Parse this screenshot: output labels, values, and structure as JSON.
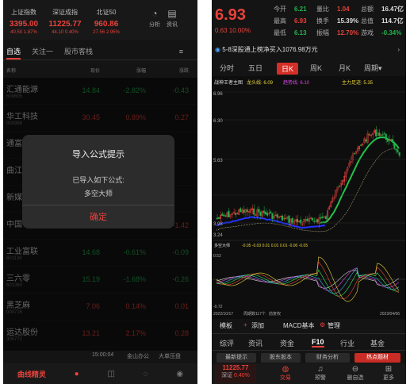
{
  "left": {
    "indices": [
      {
        "name": "上证指数",
        "value": "3395.00",
        "change": "40.50 1.87%",
        "color": "#e8413a"
      },
      {
        "name": "深证成指",
        "value": "11225.77",
        "change": "44.10 0.40%",
        "color": "#e8413a"
      },
      {
        "name": "北证50",
        "value": "960.86",
        "change": "27.56 2.95%",
        "color": "#e8413a"
      }
    ],
    "icons": [
      {
        "label": "分析",
        "icon": "chart-icon"
      },
      {
        "label": "资讯",
        "icon": "news-icon"
      }
    ],
    "tabs": {
      "selfselect": "自选",
      "follow": "关注一",
      "holding": "股市客栈"
    },
    "header": {
      "name": "名称",
      "price": "现价",
      "pct": "涨幅",
      "chg": "涨跌"
    },
    "stocks": [
      {
        "name": "汇通能源",
        "code": "600605",
        "price": "14.84",
        "pct": "-2.82%",
        "chg": "-0.43",
        "color": "#22b24c"
      },
      {
        "name": "华工科技",
        "code": "000988",
        "price": "30.45",
        "pct": "0.89%",
        "chg": "0.27",
        "color": "#e8413a"
      },
      {
        "name": "通富",
        "code": "",
        "price": "",
        "pct": "",
        "chg": "",
        "color": "#e8413a"
      },
      {
        "name": "曲江",
        "code": "",
        "price": "",
        "pct": "",
        "chg": "",
        "color": "#e8413a"
      },
      {
        "name": "新媒",
        "code": "",
        "price": "",
        "pct": "",
        "chg": "",
        "color": "#e8413a"
      },
      {
        "name": "中国",
        "code": "",
        "price": "",
        "pct": "",
        "chg": "-1.42",
        "color": "#e8413a"
      },
      {
        "name": "工业富联",
        "code": "601138",
        "price": "14.68",
        "pct": "-0.61%",
        "chg": "-0.09",
        "color": "#22b24c"
      },
      {
        "name": "三六零",
        "code": "601360",
        "price": "15.19",
        "pct": "-1.68%",
        "chg": "-0.26",
        "color": "#22b24c"
      },
      {
        "name": "黑芝麻",
        "code": "000716",
        "price": "7.06",
        "pct": "0.14%",
        "chg": "0.01",
        "color": "#e8413a"
      },
      {
        "name": "运达股份",
        "code": "300772",
        "price": "13.21",
        "pct": "2.17%",
        "chg": "0.28",
        "color": "#e8413a"
      }
    ],
    "dialog": {
      "title": "导入公式提示",
      "line1": "已导入如下公式:",
      "line2": "多空大师",
      "ok": "确定"
    },
    "footer": {
      "time": "15:00:04",
      "ad1": "金山办公",
      "ad2": "大单压盘"
    },
    "nav": {
      "brand": "曲线精灵"
    }
  },
  "right": {
    "price": "6.93",
    "change": "0.63 10.00%",
    "stats": [
      {
        "k": "今开",
        "v": "6.21",
        "vc": "#22b24c"
      },
      {
        "k": "量比",
        "v": "1.04",
        "vc": "#e8413a"
      },
      {
        "k": "总额",
        "v": "16.47亿",
        "vc": "#ddd"
      },
      {
        "k": "最高",
        "v": "6.93",
        "vc": "#e8413a"
      },
      {
        "k": "换手",
        "v": "15.39%",
        "vc": "#ddd"
      },
      {
        "k": "总值",
        "v": "114.7亿",
        "vc": "#ddd"
      },
      {
        "k": "最低",
        "v": "6.13",
        "vc": "#22b24c"
      },
      {
        "k": "振幅",
        "v": "12.70%",
        "vc": "#e8413a"
      },
      {
        "k": "游戏",
        "v": "-0.34%",
        "vc": "#22b24c"
      }
    ],
    "title": "5-8深股通上榜净买入1076.98万元",
    "periods": [
      "分时",
      "五日",
      "日K",
      "周K",
      "月K",
      "周期▾"
    ],
    "indicator": {
      "name": "战神王者主图",
      "dragon": "龙头线: 6.09",
      "trend": "趋势线: 6.10",
      "main": "主力足迹: 5.35"
    },
    "axis": {
      "p1": "6.96",
      "p2": "6.30",
      "p3": "5.63",
      "p4": "3.98",
      "p5": "3.24"
    },
    "sub": {
      "name": "多空大师",
      "vals": "-0.05  -0.03  0.01  0.01  0.01  -0.00  -0.05",
      "top": "0.52",
      "bottom": "-0.72"
    },
    "dates": {
      "start": "2022/10/17",
      "mid": "周期数117个",
      "mid2": "前复权",
      "end": "2023/04/06"
    },
    "tools": {
      "template": "模板",
      "add": "添加",
      "macd": "MACD基本",
      "manage": "管理"
    },
    "f10": [
      "综评",
      "资讯",
      "资金",
      "F10",
      "行业",
      "基金"
    ],
    "btns": [
      "最新提示",
      "股东股本",
      "财务分析",
      "热点题材"
    ],
    "nav": {
      "szindex": "11225.77",
      "szlabel": "深证",
      "szchg": "0.40%",
      "trade": "交易",
      "alert": "预警",
      "back": "删自选",
      "more": "更多"
    }
  }
}
